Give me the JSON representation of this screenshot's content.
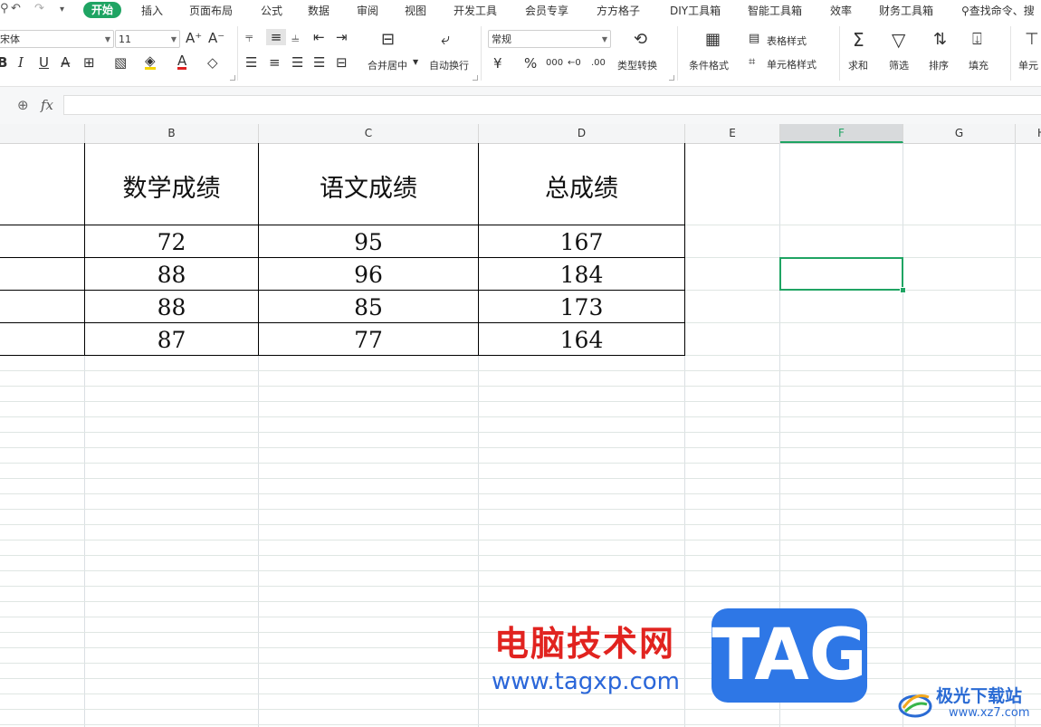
{
  "quick_access": {
    "undo_icon": "↶",
    "redo_icon": "↷",
    "more_icon": "▾"
  },
  "menu_tabs": [
    {
      "label": "开始",
      "active": true
    },
    {
      "label": "插入"
    },
    {
      "label": "页面布局"
    },
    {
      "label": "公式"
    },
    {
      "label": "数据"
    },
    {
      "label": "审阅"
    },
    {
      "label": "视图"
    },
    {
      "label": "开发工具"
    },
    {
      "label": "会员专享"
    },
    {
      "label": "方方格子"
    },
    {
      "label": "DIY工具箱"
    },
    {
      "label": "智能工具箱"
    },
    {
      "label": "效率"
    },
    {
      "label": "财务工具箱"
    }
  ],
  "search": {
    "label": "查找命令、搜"
  },
  "ribbon": {
    "font_name": "宋体",
    "font_size": "11",
    "number_format": "常规",
    "bold": "B",
    "italic": "I",
    "underline": "U",
    "labels": {
      "merge_center": "合并居中",
      "wrap_text": "自动换行",
      "type_convert": "类型转换",
      "conditional_format": "条件格式",
      "table_style": "表格样式",
      "cell_style": "单元格样式",
      "sum": "求和",
      "filter": "筛选",
      "sort": "排序",
      "fill": "填充",
      "cell": "单元"
    },
    "currency_symbol": "¥",
    "percent_symbol": "%"
  },
  "formula_bar": {
    "fx_label": "fx",
    "value": ""
  },
  "columns": [
    "B",
    "C",
    "D",
    "E",
    "F",
    "G",
    "H"
  ],
  "selected_column": "F",
  "table": {
    "headers": [
      "数学成绩",
      "语文成绩",
      "总成绩"
    ],
    "rows": [
      [
        "72",
        "95",
        "167"
      ],
      [
        "88",
        "96",
        "184"
      ],
      [
        "88",
        "85",
        "173"
      ],
      [
        "87",
        "77",
        "164"
      ]
    ]
  },
  "watermark": {
    "cn_text": "电脑技术网",
    "url": "www.tagxp.com",
    "tag": "TAG",
    "site_name": "极光下载站",
    "site_url": "www.xz7.com"
  },
  "colors": {
    "accent": "#1fa463",
    "watermark_red": "#e1231f",
    "watermark_blue": "#2e77e6"
  }
}
